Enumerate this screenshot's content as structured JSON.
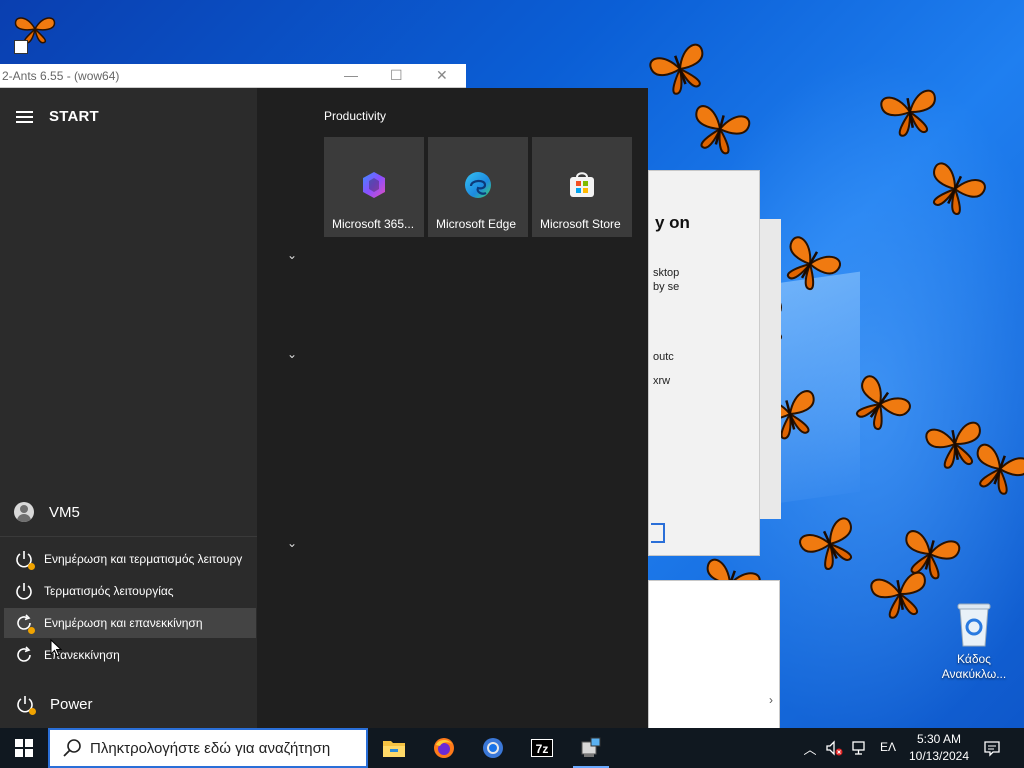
{
  "background_window": {
    "title": "2-Ants 6.55 -  (wow64)",
    "min": "—",
    "max": "☐",
    "close": "✕"
  },
  "dialog": {
    "heading": "y on",
    "lines": [
      "sktop",
      "by se",
      "outc",
      "xrw"
    ]
  },
  "start_menu": {
    "title": "START",
    "user": "VM5",
    "power_options": [
      "Ενημέρωση και τερματισμός λειτουργ",
      "Τερματισμός λειτουργίας",
      "Ενημέρωση και επανεκκίνηση",
      "Επανεκκίνηση"
    ],
    "power_label": "Power",
    "group_label": "Productivity",
    "tiles": [
      {
        "label": "Microsoft 365...",
        "icon": "m365-icon"
      },
      {
        "label": "Microsoft Edge",
        "icon": "edge-icon"
      },
      {
        "label": "Microsoft Store",
        "icon": "store-icon"
      }
    ]
  },
  "taskbar": {
    "search_placeholder": "Πληκτρολογήστε εδώ για αναζήτηση",
    "apps": [
      "file-explorer-icon",
      "firefox-icon",
      "chrome-icon",
      "7zip-icon",
      "network-app-icon"
    ],
    "language": "ΕΛ",
    "time": "5:30 AM",
    "date": "10/13/2024"
  },
  "desktop": {
    "recycle_bin_label": "Κάδος Ανακύκλω..."
  },
  "colors": {
    "accent": "#2a6fd8",
    "start_left": "#2b2b2b",
    "start_right": "#1f1f1f",
    "tile": "#3b3b3b",
    "update_dot": "#f0a300",
    "butterfly": "#f07a10"
  }
}
